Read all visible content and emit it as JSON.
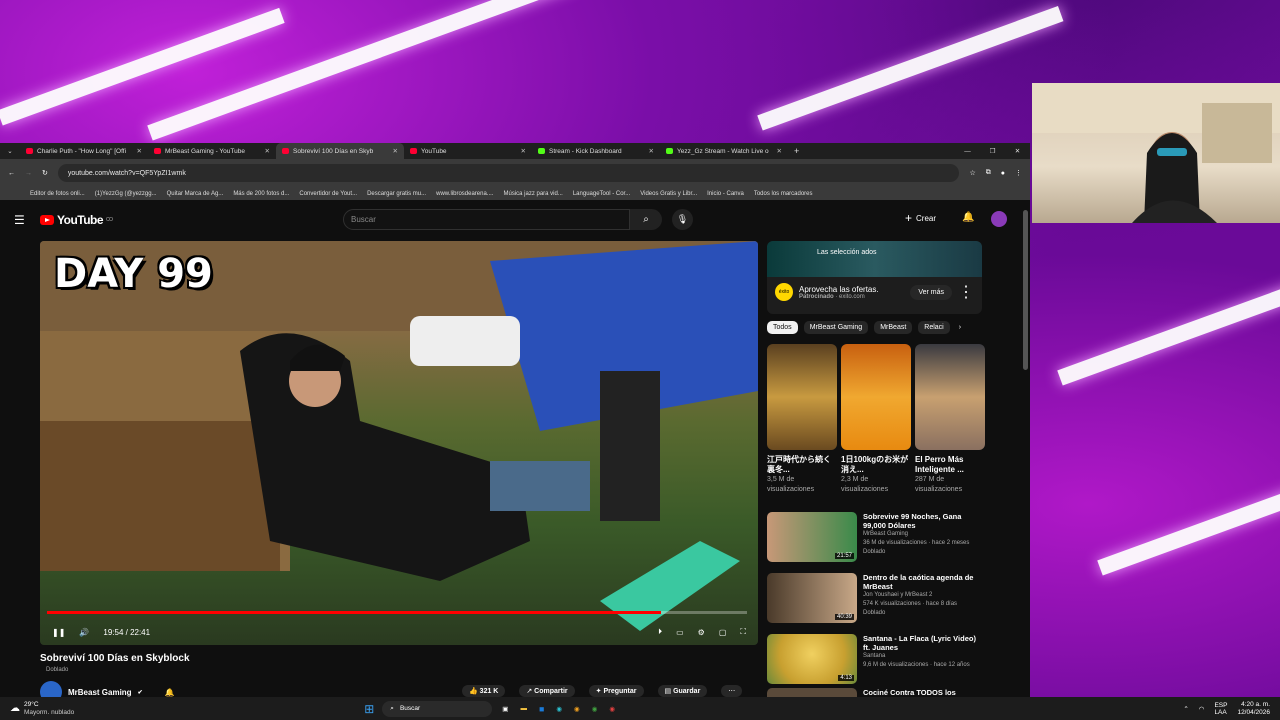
{
  "tabs": [
    {
      "title": "Charlie Puth - \"How Long\" [Offi",
      "color": "#ff0033"
    },
    {
      "title": "MrBeast Gaming - YouTube",
      "color": "#ff0033"
    },
    {
      "title": "Sobreviví 100 Días en Skyb",
      "color": "#ff0033",
      "active": true
    },
    {
      "title": "YouTube",
      "color": "#ff0033"
    },
    {
      "title": "Stream - Kick Dashboard",
      "color": "#53fc18"
    },
    {
      "title": "Yezz_Gz Stream - Watch Live o",
      "color": "#53fc18"
    }
  ],
  "address": {
    "url": "youtube.com/watch?v=QF5YpZI1wmk"
  },
  "bookmarks": [
    "Editor de fotos onli...",
    "(1)YezzGg (@yezzgg...",
    "Quitar Marca de Ag...",
    "Más de 200 fotos d...",
    "Convertidor de Yout...",
    "Descargar gratis mu...",
    "www.librosdearena....",
    "Música jazz para vid...",
    "LanguageTool - Cor...",
    "Videos Gratis y Libr...",
    "Inicio - Canva",
    "Todos los marcadores"
  ],
  "header": {
    "logo": "YouTube",
    "country": "CO",
    "search_placeholder": "Buscar",
    "create_label": "Crear"
  },
  "player": {
    "overlay_text": "DAY 99",
    "time": "19:54 / 22:41",
    "progress": 0.877
  },
  "video": {
    "title": "Sobreviví 100 Días en Skyblock",
    "dub_label": "Doblado",
    "channel": "MrBeast Gaming",
    "likes": "321 K",
    "share": "Compartir",
    "ask": "Preguntar",
    "save": "Guardar"
  },
  "ad": {
    "banner_text": "Las selección ados",
    "title": "Aprovecha las ofertas.",
    "sponsor": "Patrocinado",
    "domain": "exito.com",
    "cta": "Ver más",
    "brand": "éxito"
  },
  "chips": [
    "Todos",
    "MrBeast Gaming",
    "MrBeast",
    "Relaci"
  ],
  "shorts": [
    {
      "title": "江戸時代から続く裏冬...",
      "views": "3,5 M de visualizaciones",
      "color": "#c89a40"
    },
    {
      "title": "1日100kgのお米が消え...",
      "views": "2,3 M de visualizaciones",
      "color": "#e8a020"
    },
    {
      "title": "El Perro Más Inteligente ...",
      "views": "287 M de visualizaciones",
      "color": "#c8a070"
    }
  ],
  "recs": [
    {
      "title": "Sobrevive 99 Noches, Gana 99,000 Dólares",
      "channel": "MrBeast Gaming",
      "meta": "36 M de visualizaciones · hace 2 meses",
      "badge": "Doblado",
      "duration": "21:57",
      "color": "#3a8a4a"
    },
    {
      "title": "Dentro de la caótica agenda de MrBeast",
      "channel": "Jon Youshaei y MrBeast 2",
      "meta": "574 K visualizaciones · hace 8 días",
      "badge": "Doblado",
      "duration": "40:39",
      "color": "#6a5a4a"
    },
    {
      "title": "Santana - La Flaca (Lyric Video) ft. Juanes",
      "channel": "Santana",
      "meta": "9,6 M de visualizaciones · hace 12 años",
      "badge": "",
      "duration": "4:13",
      "color": "#c8a030"
    },
    {
      "title": "Cociné Contra TODOS los",
      "channel": "",
      "meta": "",
      "badge": "",
      "duration": "",
      "color": "#5a4a3a"
    }
  ],
  "taskbar": {
    "temp": "29°C",
    "weather": "Mayorm. nublado",
    "search": "Buscar",
    "lang": "ESP\nLAA",
    "time": "4:20 a. m.",
    "date": "12/04/2026"
  }
}
